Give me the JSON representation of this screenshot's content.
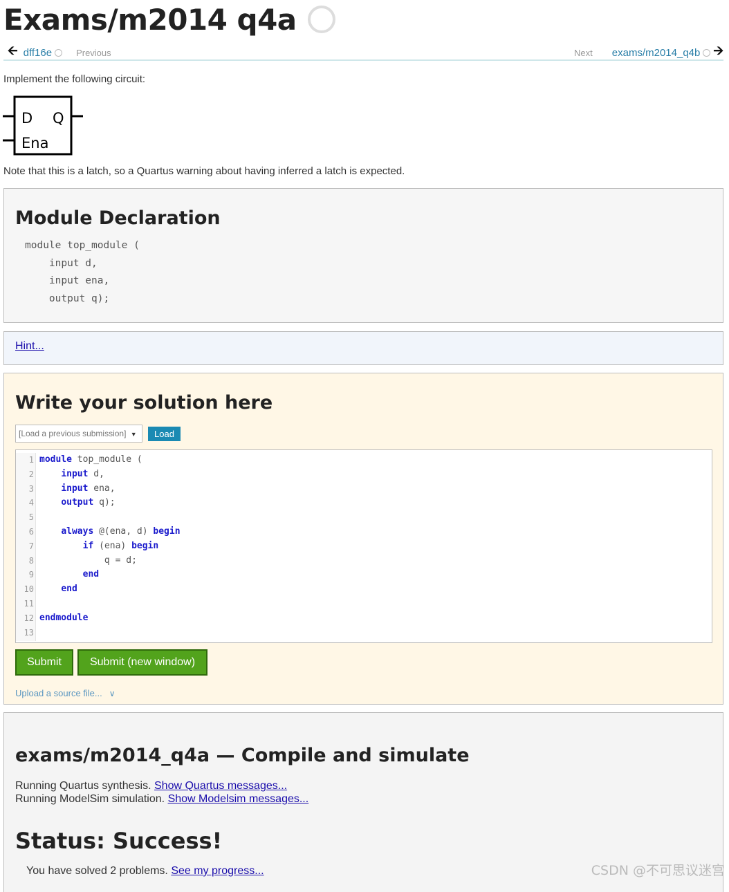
{
  "header": {
    "title": "Exams/m2014 q4a"
  },
  "nav": {
    "prev_link": "dff16e",
    "prev_label": "Previous",
    "next_label": "Next",
    "next_link": "exams/m2014_q4b"
  },
  "intro": "Implement the following circuit:",
  "circuit": {
    "d_label": "D",
    "q_label": "Q",
    "ena_label": "Ena"
  },
  "note": "Note that this is a latch, so a Quartus warning about having inferred a latch is expected.",
  "declaration": {
    "heading": "Module Declaration",
    "code": "module top_module (\n    input d,\n    input ena,\n    output q);"
  },
  "hint": {
    "label": "Hint..."
  },
  "solution": {
    "heading": "Write your solution here",
    "select_placeholder": "[Load a previous submission]",
    "load_label": "Load",
    "submit_label": "Submit",
    "submit_new_label": "Submit (new window)",
    "upload_label": "Upload a source file...",
    "code_lines": [
      "module top_module (",
      "    input d,",
      "    input ena,",
      "    output q);",
      "",
      "    always @(ena, d) begin",
      "        if (ena) begin",
      "            q = d;",
      "        end",
      "    end",
      "",
      "endmodule",
      ""
    ]
  },
  "result": {
    "heading": "exams/m2014_q4a — Compile and simulate",
    "quartus_text": "Running Quartus synthesis.",
    "quartus_link": "Show Quartus messages...",
    "modelsim_text": "Running ModelSim simulation.",
    "modelsim_link": "Show Modelsim messages...",
    "status": "Status: Success!",
    "solved_text": "You have solved 2 problems.",
    "progress_link": "See my progress..."
  },
  "watermark": "CSDN @不可思议迷宫",
  "colors": {
    "link": "#2a7fa8",
    "submit_green": "#52a31c",
    "keyword": "#1a1acc"
  }
}
